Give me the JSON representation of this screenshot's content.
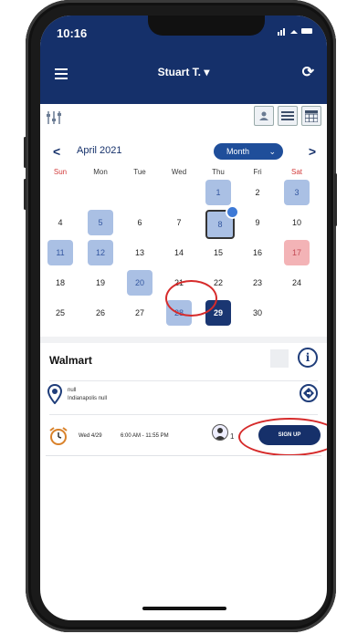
{
  "status_bar": {
    "time": "10:16",
    "icons": "··· ≡ ▬"
  },
  "app_bar": {
    "title": "Stuart T.",
    "menu_icon": "hamburger-icon",
    "refresh_icon": "refresh-icon",
    "dropdown_icon": "caret-down-icon"
  },
  "calendar": {
    "month_label": "April 2021",
    "view_label": "Month",
    "prev_glyph": "<",
    "next_glyph": ">",
    "weekdays": [
      "Sun",
      "Mon",
      "Tue",
      "Wed",
      "Thu",
      "Fri",
      "Sat"
    ],
    "days": [
      "1",
      "2",
      "3",
      "4",
      "5",
      "6",
      "7",
      "8",
      "9",
      "10",
      "11",
      "12",
      "13",
      "14",
      "15",
      "16",
      "17",
      "18",
      "19",
      "20",
      "21",
      "22",
      "23",
      "24",
      "25",
      "26",
      "27",
      "28",
      "29",
      "30"
    ],
    "highlighted_days": [
      "1",
      "3",
      "5",
      "8",
      "11",
      "12",
      "20",
      "28"
    ],
    "pink_days": [
      "17"
    ],
    "today_day": "8",
    "selected_day": "29"
  },
  "event": {
    "title": "Walmart",
    "location_line1": "null",
    "location_line2": "Indianapolis null",
    "date": "Wed 4/29",
    "time": "6:00 AM - 11:55 PM",
    "attendee_count": "1",
    "signup_label": "SIGN UP"
  },
  "colors": {
    "primary": "#15306a",
    "highlight": "#aac0e4",
    "pink": "#f3b3b6",
    "annotation": "#d62b2b"
  }
}
